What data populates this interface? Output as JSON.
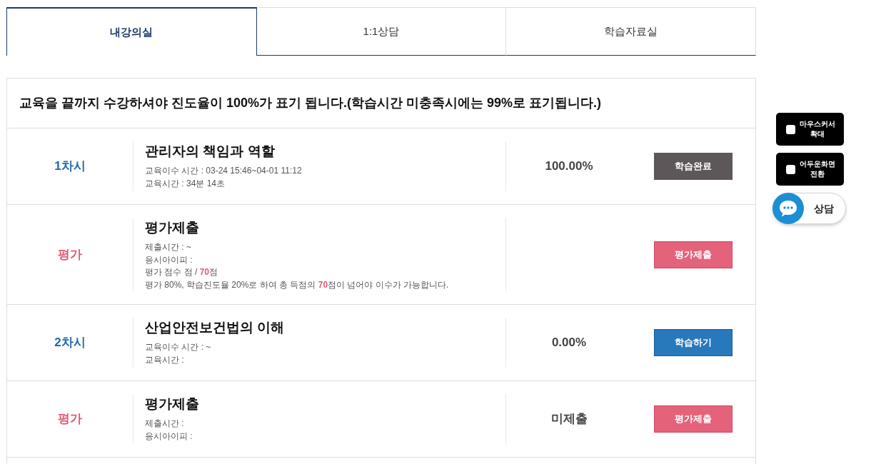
{
  "tabs": [
    {
      "label": "내강의실",
      "selected": true
    },
    {
      "label": "1:1상담",
      "selected": false
    },
    {
      "label": "학습자료실",
      "selected": false
    }
  ],
  "notice": "교육을 끝까지 수강하셔야 진도율이 100%가 표기 됩니다.(학습시간 미충족시에는 99%로 표기됩니다.)",
  "rows": [
    {
      "kind": "lesson",
      "label": "1차시",
      "title": "관리자의 책임과 역할",
      "details": [
        "교육이수 시간 : 03-24 15:46~04-01 11:12",
        "교육시간 : 34분 14초"
      ],
      "progress": "100.00%",
      "button": {
        "kind": "done",
        "label": "학습완료"
      }
    },
    {
      "kind": "exam",
      "label": "평가",
      "title": "평가제출",
      "details": [
        "제출시간 : ~",
        "응시아이피 :",
        "평가 점수 점 / **70**점",
        "평가 80%, 학습진도율 20%로 하여 총 득점의 **70**점이 넘어야 이수가 가능합니다."
      ],
      "button": {
        "kind": "submit",
        "label": "평가제출"
      }
    },
    {
      "kind": "lesson",
      "label": "2차시",
      "title": "산업안전보건법의 이해",
      "details": [
        "교육이수 시간 : ~",
        "교육시간 :"
      ],
      "progress": "0.00%",
      "button": {
        "kind": "study",
        "label": "학습하기"
      }
    },
    {
      "kind": "exam",
      "label": "평가",
      "title": "평가제출",
      "details": [
        "제출시간 :",
        "응시아이피 :"
      ],
      "progress": "미제출",
      "button": {
        "kind": "submit",
        "label": "평가제출"
      }
    }
  ],
  "quick_menu": [
    {
      "kind": "toggle",
      "label": "마우스커서 확대",
      "checked": false
    },
    {
      "kind": "toggle",
      "label": "어두운화면 전환",
      "checked": false
    },
    {
      "kind": "chat",
      "label": "상담"
    }
  ]
}
